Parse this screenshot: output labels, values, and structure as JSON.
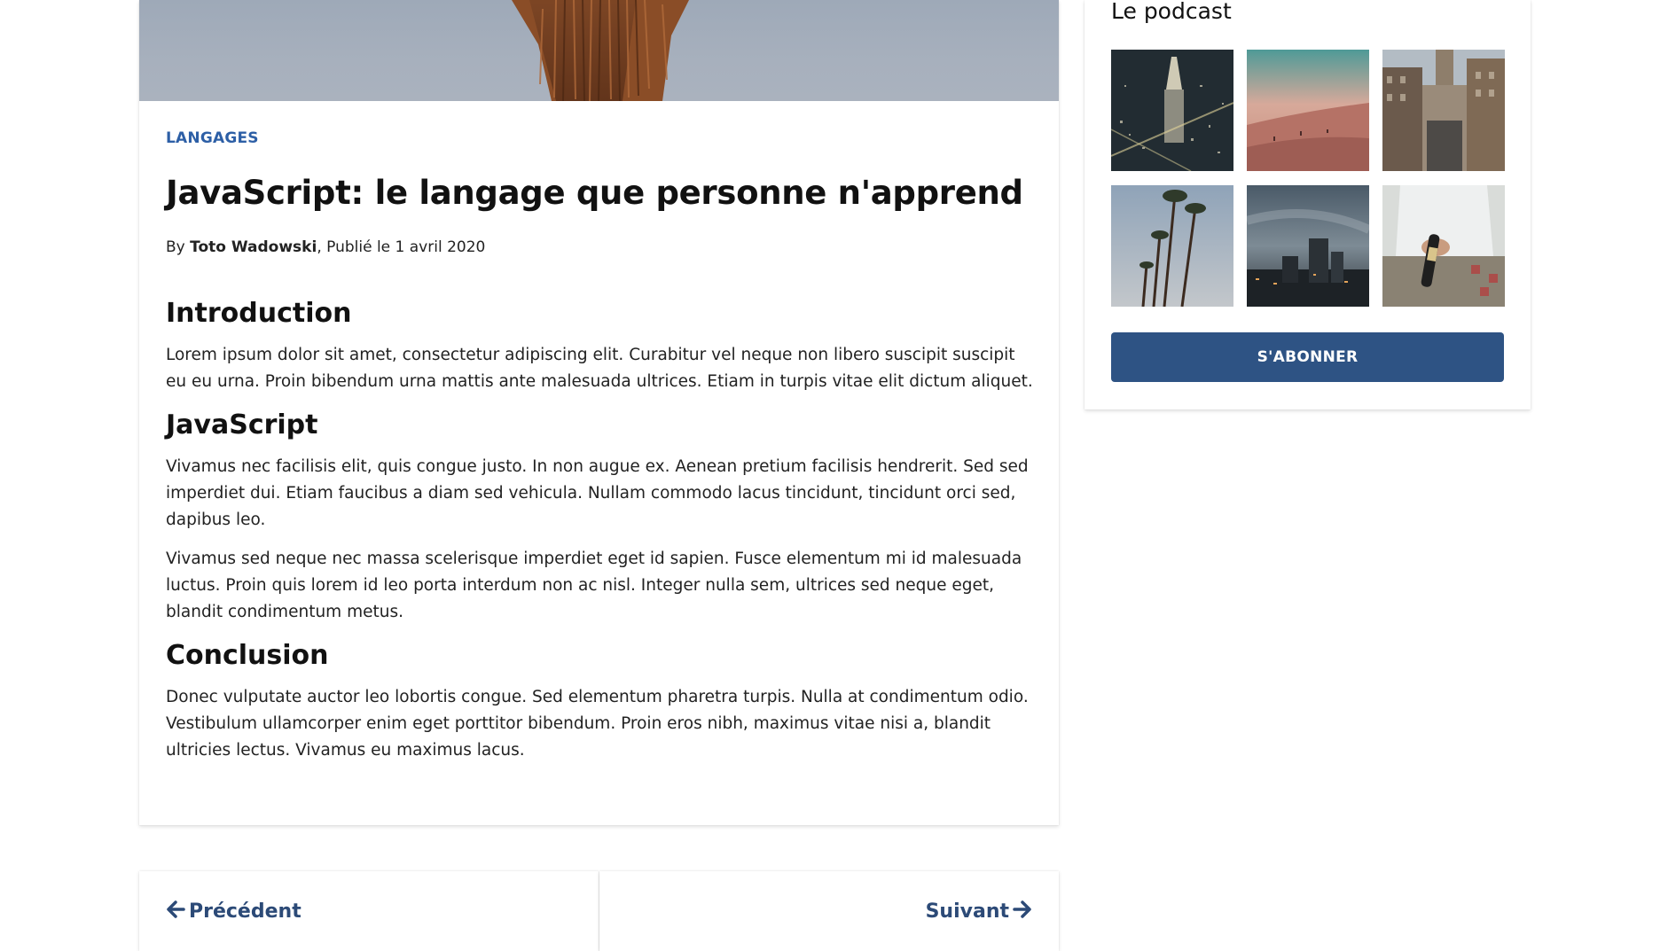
{
  "article": {
    "category": "LANGAGES",
    "title": "JavaScript: le langage que personne n'apprend",
    "byline_prefix": "By ",
    "author": "Toto Wadowski",
    "byline_suffix": ", Publié le 1 avril 2020",
    "sections": [
      {
        "heading": "Introduction",
        "paragraphs": [
          "Lorem ipsum dolor sit amet, consectetur adipiscing elit. Curabitur vel neque non libero suscipit suscipit eu eu urna. Proin bibendum urna mattis ante malesuada ultrices. Etiam in turpis vitae elit dictum aliquet."
        ]
      },
      {
        "heading": "JavaScript",
        "paragraphs": [
          "Vivamus nec facilisis elit, quis congue justo. In non augue ex. Aenean pretium facilisis hendrerit. Sed sed imperdiet dui. Etiam faucibus a diam sed vehicula. Nullam commodo lacus tincidunt, tincidunt orci sed, dapibus leo.",
          "Vivamus sed neque nec massa scelerisque imperdiet eget id sapien. Fusce elementum mi id malesuada luctus. Proin quis lorem id leo porta interdum non ac nisl. Integer nulla sem, ultrices sed neque eget, blandit condimentum metus."
        ]
      },
      {
        "heading": "Conclusion",
        "paragraphs": [
          "Donec vulputate auctor leo lobortis congue. Sed elementum pharetra turpis. Nulla at condimentum odio. Vestibulum ullamcorper enim eget porttitor bibendum. Proin eros nibh, maximus vitae nisi a, blandit ultricies lectus. Vivamus eu maximus lacus."
        ]
      }
    ]
  },
  "pagination": {
    "prev_label": "Précédent",
    "next_label": "Suivant",
    "prev_icon": "arrow-left-icon",
    "next_icon": "arrow-right-icon"
  },
  "sidebar": {
    "title": "Le podcast",
    "thumbnails": [
      {
        "name": "city-night-aerial"
      },
      {
        "name": "beach-sunset"
      },
      {
        "name": "city-street"
      },
      {
        "name": "palm-trees"
      },
      {
        "name": "city-skyline-dusk"
      },
      {
        "name": "man-with-bottle"
      }
    ],
    "subscribe_label": "S'ABONNER"
  },
  "colors": {
    "accent": "#2e5384",
    "category": "#2d5fa6",
    "pager_link": "#2c4a77"
  }
}
